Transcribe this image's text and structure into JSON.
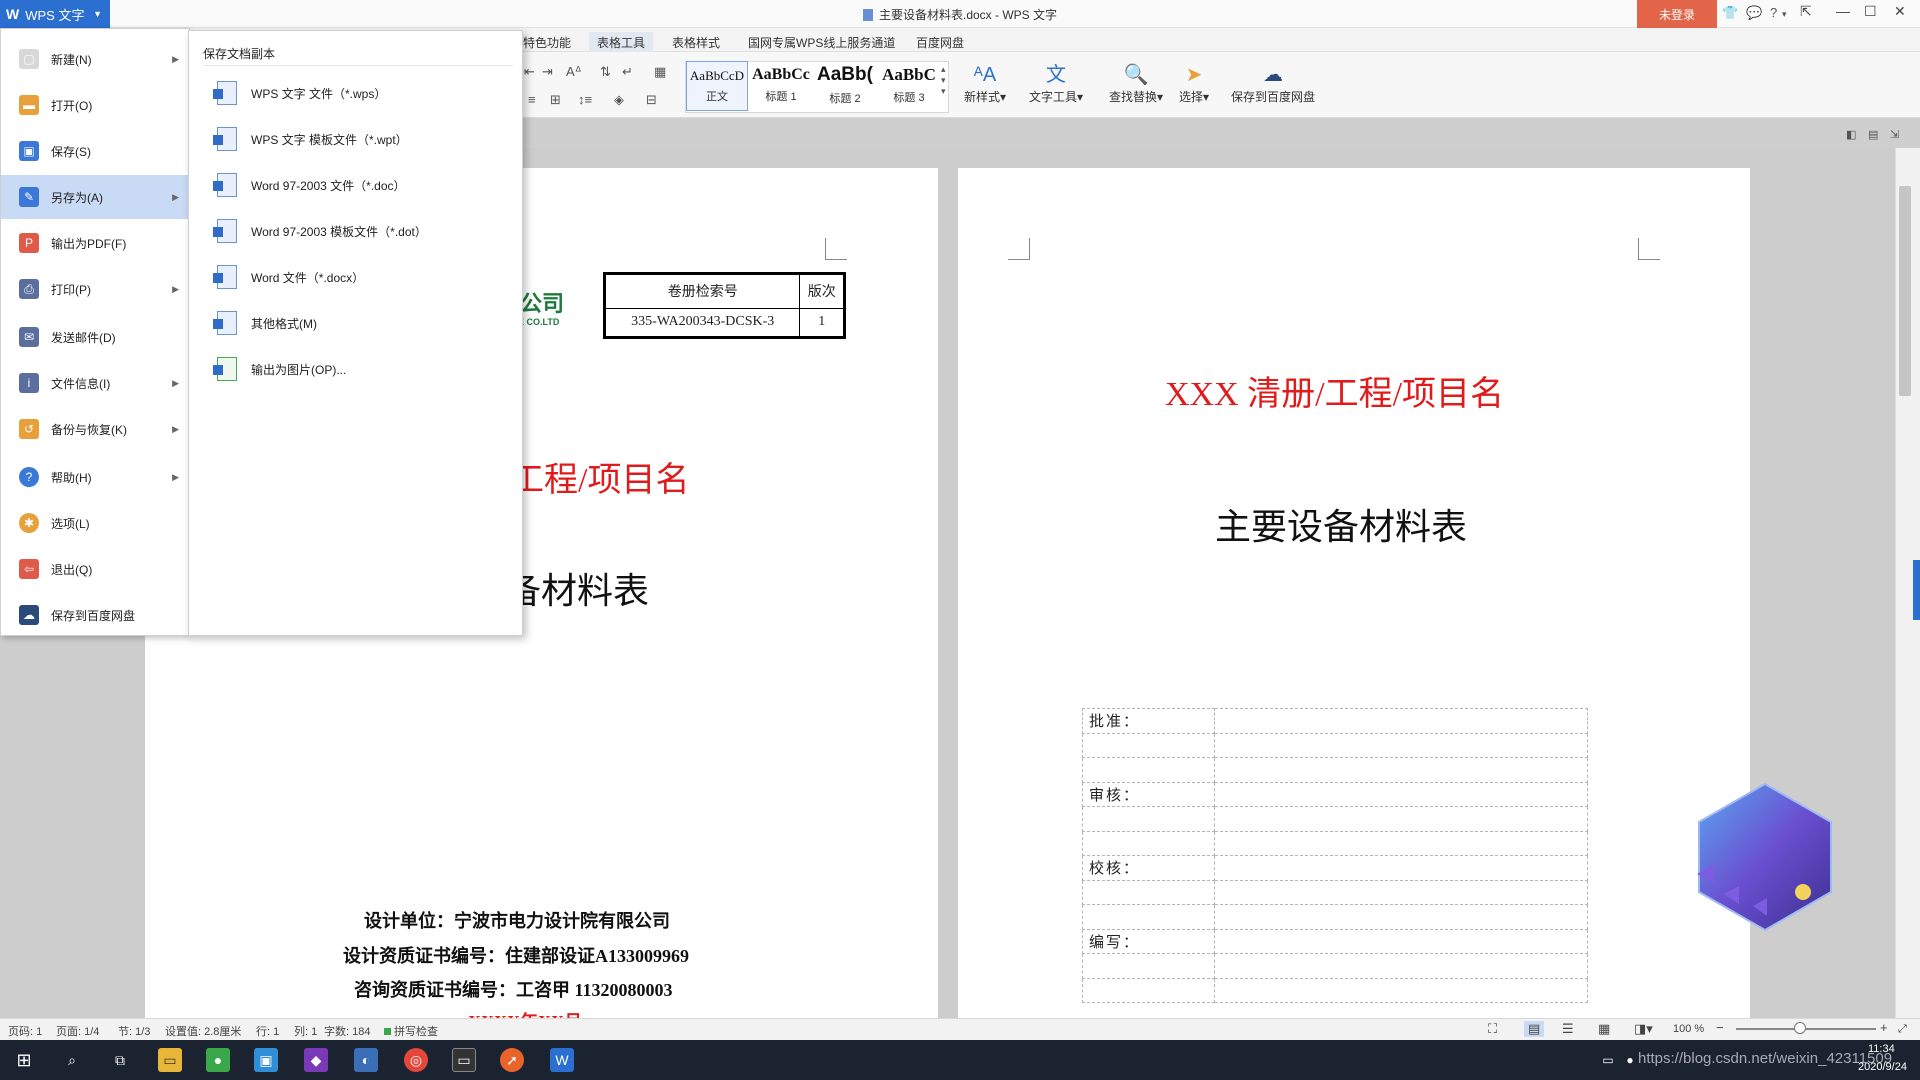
{
  "titlebar": {
    "app_button": "WPS 文字",
    "doc_title": "主要设备材料表.docx - WPS 文字",
    "login": "未登录"
  },
  "ribbon_tabs": [
    "特色功能",
    "表格工具",
    "表格样式",
    "国网专属WPS线上服务通道",
    "百度网盘"
  ],
  "ribbon": {
    "styles": [
      {
        "sample": "AaBbCcD",
        "label": "正文"
      },
      {
        "sample": "AaBbCc",
        "label": "标题 1"
      },
      {
        "sample": "AaBb(",
        "label": "标题 2"
      },
      {
        "sample": "AaBbC",
        "label": "标题 3"
      }
    ],
    "new_style": "新样式",
    "text_tools": "文字工具",
    "find_replace": "查找替换",
    "select": "选择",
    "save_baidu": "保存到百度网盘"
  },
  "file_menu": {
    "items": [
      {
        "label": "新建(N)",
        "arrow": true,
        "color": "#d8d8d8",
        "icon": "new-icon"
      },
      {
        "label": "打开(O)",
        "arrow": false,
        "color": "#e8a13a",
        "icon": "open-folder-icon"
      },
      {
        "label": "保存(S)",
        "arrow": false,
        "color": "#3b78d8",
        "icon": "save-icon"
      },
      {
        "label": "另存为(A)",
        "arrow": true,
        "color": "#3b78d8",
        "icon": "save-as-icon",
        "active": true
      },
      {
        "label": "输出为PDF(F)",
        "arrow": false,
        "color": "#e05a4a",
        "icon": "pdf-icon"
      },
      {
        "label": "打印(P)",
        "arrow": true,
        "color": "#5a6f9e",
        "icon": "print-icon"
      },
      {
        "label": "发送邮件(D)",
        "arrow": false,
        "color": "#5a6f9e",
        "icon": "mail-icon"
      },
      {
        "label": "文件信息(I)",
        "arrow": true,
        "color": "#5a6f9e",
        "icon": "file-info-icon"
      },
      {
        "label": "备份与恢复(K)",
        "arrow": true,
        "color": "#e8a13a",
        "icon": "backup-icon"
      },
      {
        "label": "帮助(H)",
        "arrow": true,
        "color": "#3b78d8",
        "icon": "help-icon"
      },
      {
        "label": "选项(L)",
        "arrow": false,
        "color": "#e8a13a",
        "icon": "options-gear-icon"
      },
      {
        "label": "退出(Q)",
        "arrow": false,
        "color": "#e05a4a",
        "icon": "exit-icon"
      },
      {
        "label": "保存到百度网盘",
        "arrow": false,
        "color": "#2a4a7a",
        "icon": "baidu-cloud-icon"
      }
    ]
  },
  "save_as_submenu": {
    "title": "保存文档副本",
    "items": [
      "WPS 文字 文件（*.wps）",
      "WPS 文字 模板文件（*.wpt）",
      "Word 97-2003 文件（*.doc）",
      "Word 97-2003 模板文件（*.dot）",
      "Word 文件（*.docx）",
      "其他格式(M)",
      "输出为图片(OP)..."
    ]
  },
  "page1": {
    "logo_text": "公司",
    "logo_sub": "E CO.LTD",
    "index_table": {
      "h1": "卷册检索号",
      "h2": "版次",
      "v1": "335-WA200343-DCSK-3",
      "v2": "1"
    },
    "red_title": "工程/项目名",
    "black_title": "备材料表",
    "design_unit": "设计单位：宁波市电力设计院有限公司",
    "cert_no": "设计资质证书编号：住建部设证A133009969",
    "consult_no": "咨询资质证书编号：工咨甲 11320080003",
    "date_partial": "XXXX年XX月"
  },
  "page2": {
    "red_title": "XXX 清册/工程/项目名",
    "black_title": "主要设备材料表",
    "approvals": [
      "批准：",
      "审核：",
      "校核：",
      "编写："
    ]
  },
  "statusbar": {
    "page_code": "页码: 1",
    "pages": "页面: 1/4",
    "section": "节: 1/3",
    "setting": "设置值: 2.8厘米",
    "row": "行: 1",
    "col": "列: 1",
    "words": "字数: 184",
    "spell": "拼写检查",
    "zoom": "100 %"
  },
  "taskbar": {
    "time": "11:34",
    "date": "2020/9/24",
    "watermark": "https://blog.csdn.net/weixin_42311509"
  }
}
